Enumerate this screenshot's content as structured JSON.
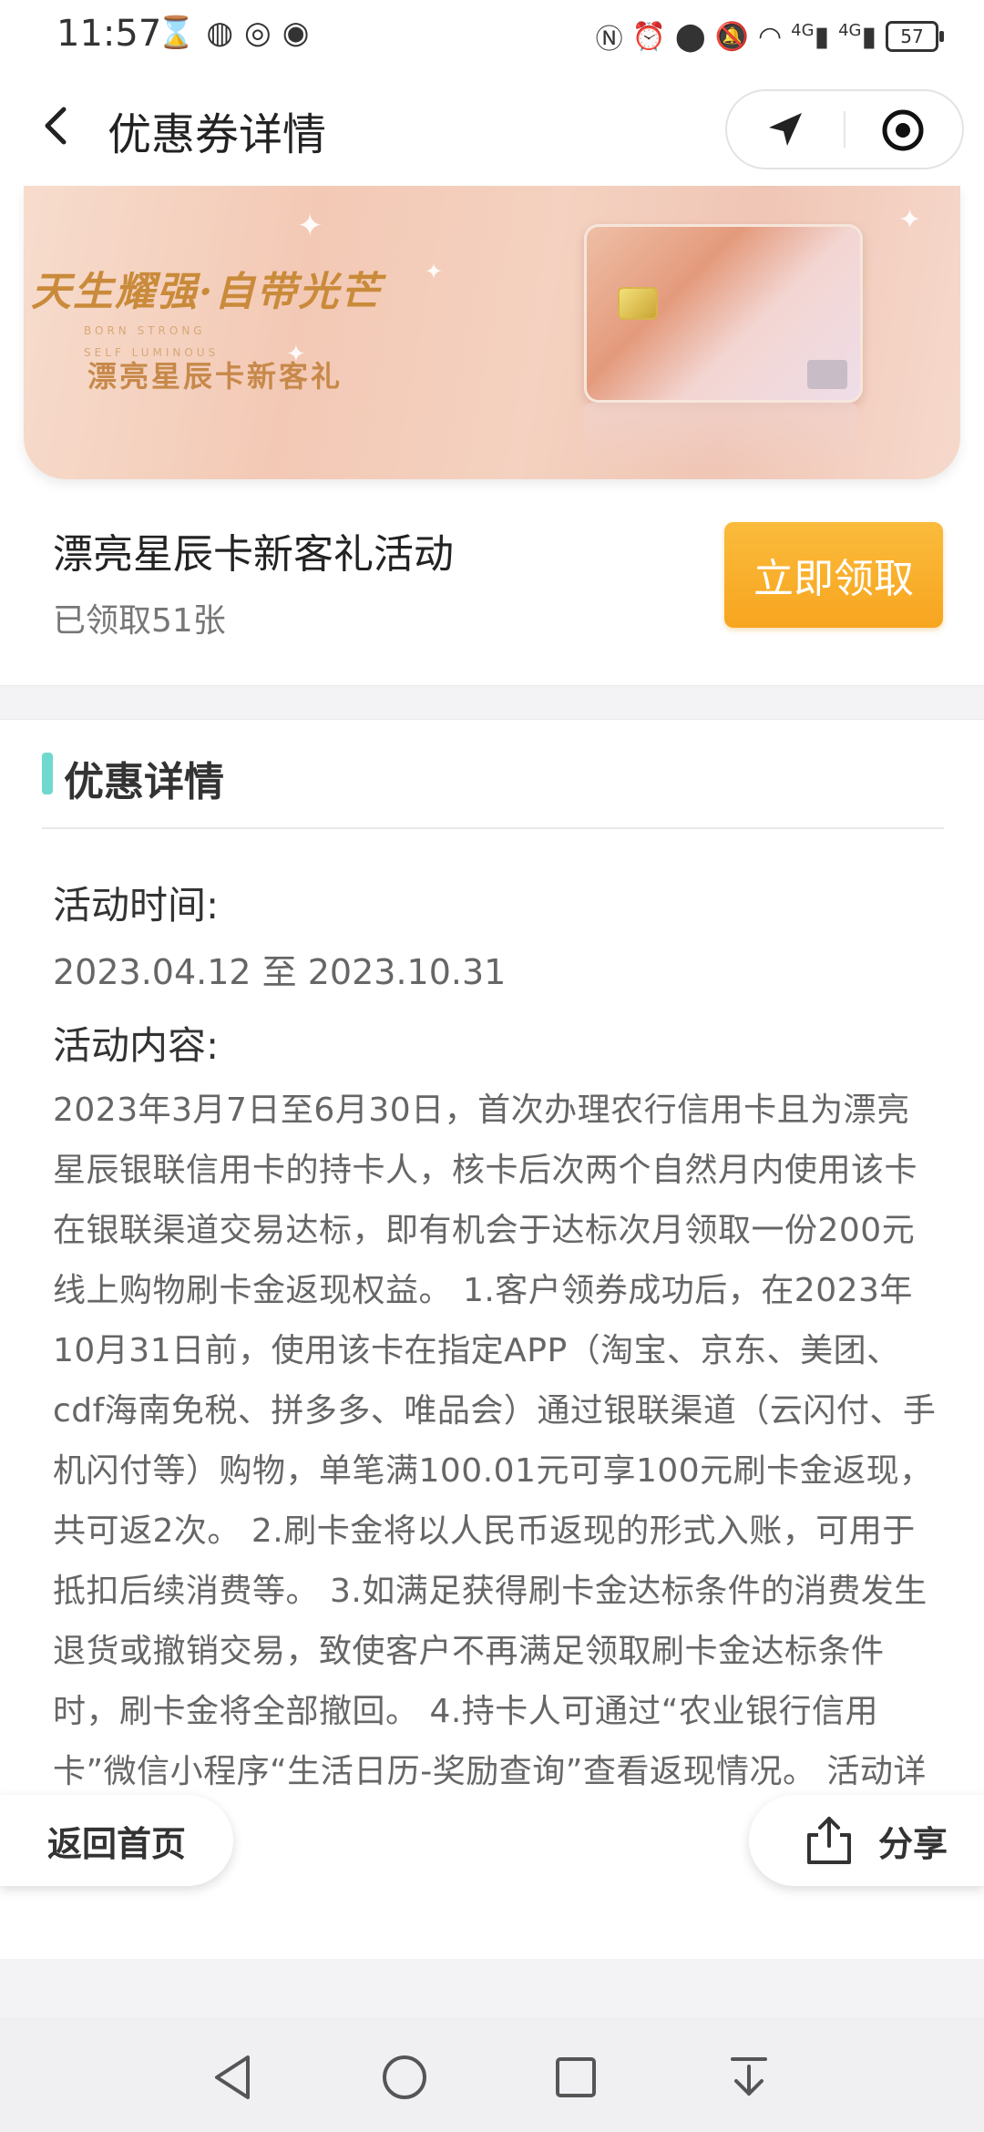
{
  "status_bar": {
    "time": "11:57",
    "battery": "57",
    "network_label": "4G"
  },
  "header": {
    "title": "优惠券详情"
  },
  "banner": {
    "headline": "天生耀强·自带光芒",
    "sub_line_1": "BORN STRONG",
    "sub_line_2": "SELF LUMINOUS",
    "gift_text": "漂亮星辰卡新客礼"
  },
  "coupon": {
    "name": "漂亮星辰卡新客礼活动",
    "claimed_count": "已领取51张",
    "claim_button": "立即领取"
  },
  "details": {
    "section_title": "优惠详情",
    "time_label": "活动时间:",
    "time_value": "2023.04.12 至 2023.10.31",
    "content_label": "活动内容:",
    "content_text": "2023年3月7日至6月30日，首次办理农行信用卡且为漂亮星辰银联信用卡的持卡人，核卡后次两个自然月内使用该卡在银联渠道交易达标，即有机会于达标次月领取一份200元线上购物刷卡金返现权益。 1.客户领券成功后，在2023年10月31日前，使用该卡在指定APP（淘宝、京东、美团、cdf海南免税、拼多多、唯品会）通过银联渠道（云闪付、手机闪付等）购物，单笔满100.01元可享100元刷卡金返现，共可返2次。 2.刷卡金将以人民币返现的形式入账，可用于抵扣后续消费等。 3.如满足获得刷卡金达标条件的消费发生退货或撤销交易，致使客户不再满足领取刷卡金达标条件时，刷卡金将全部撤回。 4.持卡人可通过“农业银行信用卡”微信小程序“生活日历-奖励查询”查看返现情况。 活动详情请见官网。"
  },
  "floating": {
    "home_label": "返回首页",
    "share_label": "分享"
  },
  "colors": {
    "accent_orange": "#f7a51f",
    "section_bar": "#6fd8cf"
  }
}
